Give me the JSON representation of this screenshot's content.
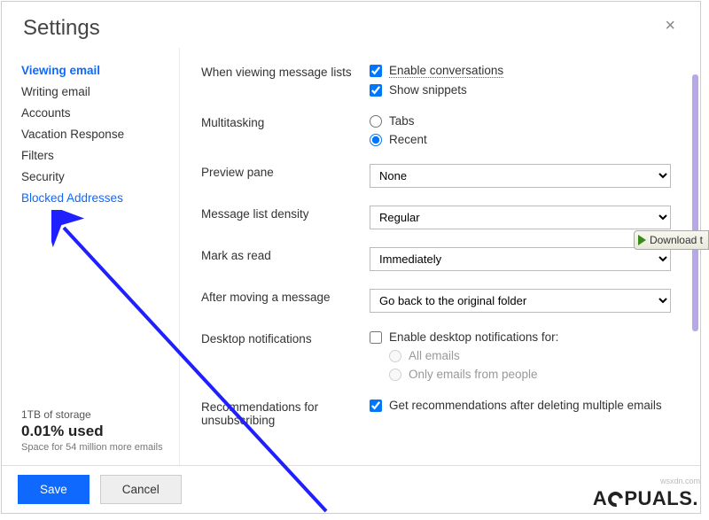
{
  "header": {
    "title": "Settings",
    "close_label": "×"
  },
  "sidebar": {
    "items": [
      {
        "label": "Viewing email"
      },
      {
        "label": "Writing email"
      },
      {
        "label": "Accounts"
      },
      {
        "label": "Vacation Response"
      },
      {
        "label": "Filters"
      },
      {
        "label": "Security"
      },
      {
        "label": "Blocked Addresses"
      }
    ]
  },
  "storage": {
    "capacity": "1TB of storage",
    "used": "0.01% used",
    "detail": "Space for 54 million more emails"
  },
  "settings": {
    "viewing_label": "When viewing message lists",
    "enable_conversations": "Enable conversations",
    "show_snippets": "Show snippets",
    "multitasking_label": "Multitasking",
    "tabs": "Tabs",
    "recent": "Recent",
    "preview_label": "Preview pane",
    "preview_value": "None",
    "density_label": "Message list density",
    "density_value": "Regular",
    "markread_label": "Mark as read",
    "markread_value": "Immediately",
    "aftermove_label": "After moving a message",
    "aftermove_value": "Go back to the original folder",
    "desktop_label": "Desktop notifications",
    "desktop_enable": "Enable desktop notifications for:",
    "desktop_all": "All emails",
    "desktop_people": "Only emails from people",
    "recs_label": "Recommendations for unsubscribing",
    "recs_value": "Get recommendations after deleting multiple emails"
  },
  "footer": {
    "save": "Save",
    "cancel": "Cancel"
  },
  "overlay": {
    "download": "Download t",
    "watermark_pre": "A",
    "watermark_post": "PUALS.",
    "credit": "wsxdn.com"
  }
}
